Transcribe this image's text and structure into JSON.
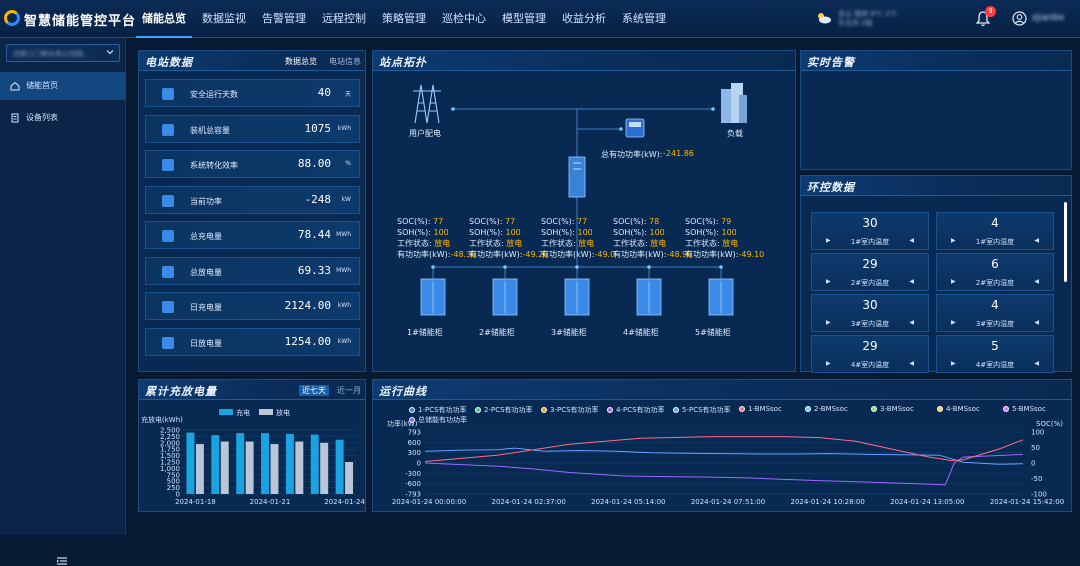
{
  "app": {
    "title": "智慧储能管控平台"
  },
  "nav": [
    "储能总览",
    "数据监视",
    "告警管理",
    "远程控制",
    "策略管理",
    "巡检中心",
    "模型管理",
    "收益分析",
    "系统管理"
  ],
  "header": {
    "weather": "多云 晴转 8℃ 2℃",
    "weather2": "东北风 2级",
    "notifications": "9",
    "username": "zjianbo"
  },
  "sidebar": {
    "org": "河南三门峡水务公司园...",
    "items": [
      "储能首页",
      "设备列表"
    ]
  },
  "station": {
    "title": "电站数据",
    "tabs": [
      "数据总览",
      "电站信息"
    ],
    "stats": [
      {
        "label": "安全运行天数",
        "value": "40",
        "unit": "天"
      },
      {
        "label": "装机总容量",
        "value": "1075",
        "unit": "kWh"
      },
      {
        "label": "系统转化效率",
        "value": "88.00",
        "unit": "%"
      },
      {
        "label": "当前功率",
        "value": "-248",
        "unit": "kW"
      },
      {
        "label": "总充电量",
        "value": "78.44",
        "unit": "MWh"
      },
      {
        "label": "总放电量",
        "value": "69.33",
        "unit": "MWh"
      },
      {
        "label": "日充电量",
        "value": "2124.00",
        "unit": "kWh"
      },
      {
        "label": "日放电量",
        "value": "1254.00",
        "unit": "kWh"
      }
    ]
  },
  "topology": {
    "title": "站点拓扑",
    "grid_label": "用户配电",
    "load_label": "负载",
    "total_power_label": "总有功功率(kW):",
    "total_power_value": "-241.86",
    "soc_label": "SOC(%):",
    "soh_label": "SOH(%):",
    "state_label": "工作状态:",
    "power_label": "有功功率(kW):",
    "cabinets": [
      {
        "name": "1#储能柜",
        "soc": "77",
        "soh": "100",
        "state": "放电",
        "power": "-48.30"
      },
      {
        "name": "2#储能柜",
        "soc": "77",
        "soh": "100",
        "state": "放电",
        "power": "-49.20"
      },
      {
        "name": "3#储能柜",
        "soc": "77",
        "soh": "100",
        "state": "放电",
        "power": "-49.0"
      },
      {
        "name": "4#储能柜",
        "soc": "78",
        "soh": "100",
        "state": "放电",
        "power": "-48.90"
      },
      {
        "name": "5#储能柜",
        "soc": "79",
        "soh": "100",
        "state": "放电",
        "power": "-49.10"
      }
    ]
  },
  "alarms": {
    "title": "实时告警"
  },
  "env": {
    "title": "环控数据",
    "cards": [
      {
        "value": "30",
        "label": "1#室内温度"
      },
      {
        "value": "4",
        "label": "1#室内湿度"
      },
      {
        "value": "29",
        "label": "2#室内温度"
      },
      {
        "value": "6",
        "label": "2#室内湿度"
      },
      {
        "value": "30",
        "label": "3#室内温度"
      },
      {
        "value": "4",
        "label": "3#室内湿度"
      },
      {
        "value": "29",
        "label": "4#室内温度"
      },
      {
        "value": "5",
        "label": "4#室内湿度"
      }
    ]
  },
  "energy": {
    "title": "累计充放电量",
    "tabs": [
      "近七天",
      "近一月"
    ]
  },
  "curves": {
    "title": "运行曲线"
  },
  "chart_data": [
    {
      "type": "bar",
      "ylabel": "充放电(kWh)",
      "categories": [
        "2024-01-18",
        "2024-01-19",
        "2024-01-20",
        "2024-01-21",
        "2024-01-22",
        "2024-01-23",
        "2024-01-24"
      ],
      "tick_labels": [
        "2024-01-18",
        "2024-01-21",
        "2024-01-24"
      ],
      "y_ticks": [
        "2,500",
        "2,250",
        "2,000",
        "1,750",
        "1,500",
        "1,250",
        "1,000",
        "750",
        "500",
        "250",
        "0"
      ],
      "ylim": [
        0,
        2500
      ],
      "series": [
        {
          "name": "充电",
          "color": "#1aa3e0",
          "values": [
            2400,
            2300,
            2380,
            2380,
            2350,
            2320,
            2120
          ]
        },
        {
          "name": "放电",
          "color": "#b8c6d8",
          "values": [
            1950,
            2050,
            2050,
            1950,
            2050,
            2000,
            1250
          ]
        }
      ],
      "legend": "top"
    },
    {
      "type": "line",
      "ylabel_left": "功率(kW)",
      "ylabel_right": "SOC(%)",
      "x_ticks": [
        "2024-01-24 00:00:00",
        "2024-01-24 02:37:00",
        "2024-01-24 05:14:00",
        "2024-01-24 07:51:00",
        "2024-01-24 10:28:00",
        "2024-01-24 13:05:00",
        "2024-01-24 15:42:00"
      ],
      "x_range": [
        0,
        1000
      ],
      "y_left_ticks": [
        "793",
        "600",
        "300",
        "0",
        "-300",
        "-600",
        "-793"
      ],
      "y_left_range": [
        -793,
        793
      ],
      "y_right_ticks": [
        "100",
        "50",
        "0",
        "-50",
        "-100"
      ],
      "y_right_range": [
        -100,
        100
      ],
      "legend_entries": [
        "1-PCS有功功率",
        "2-PCS有功功率",
        "3-PCS有功功率",
        "4-PCS有功功率",
        "5-PCS有功功率",
        "1-BMSsoc",
        "2-BMSsoc",
        "3-BMSsoc",
        "4-BMSsoc",
        "5-BMSsoc",
        "总储能有功功率"
      ],
      "legend_colors": [
        "#3e7be6",
        "#3ecf7d",
        "#f0a020",
        "#b35cff",
        "#3eb0ff",
        "#ff6b8a",
        "#5fd0ff",
        "#8fe060",
        "#ffd040",
        "#e070ff",
        "#8060ff"
      ],
      "series": [
        {
          "name": "总储能有功功率",
          "axis": "left",
          "color": "#9b6bff",
          "x": [
            0,
            60,
            120,
            180,
            240,
            300,
            330,
            360,
            420,
            480,
            540,
            600,
            660,
            720,
            760,
            800,
            840,
            870,
            885,
            900,
            940,
            970,
            1000
          ],
          "y": [
            0,
            -40,
            -80,
            -150,
            -240,
            -300,
            -330,
            -340,
            -350,
            -360,
            -380,
            -420,
            -450,
            -480,
            -500,
            -520,
            -540,
            -560,
            0,
            150,
            180,
            200,
            220
          ]
        },
        {
          "name": "1-PCS有功功率",
          "axis": "left",
          "color": "#6aa0ff",
          "x": [
            0,
            60,
            120,
            150,
            200,
            260,
            320,
            380,
            440,
            500,
            560,
            620,
            680,
            740,
            800,
            860,
            900,
            960,
            1000
          ],
          "y": [
            300,
            330,
            340,
            380,
            300,
            320,
            300,
            260,
            250,
            240,
            230,
            230,
            240,
            220,
            210,
            200,
            20,
            -30,
            -20
          ]
        },
        {
          "name": "1-BMSsoc",
          "axis": "right",
          "color": "#ff6b8a",
          "x": [
            0,
            120,
            240,
            360,
            480,
            600,
            660,
            720,
            780,
            840,
            880,
            900,
            960,
            1000
          ],
          "y": [
            5,
            25,
            60,
            80,
            85,
            85,
            82,
            70,
            45,
            20,
            8,
            10,
            45,
            75
          ]
        }
      ]
    }
  ]
}
